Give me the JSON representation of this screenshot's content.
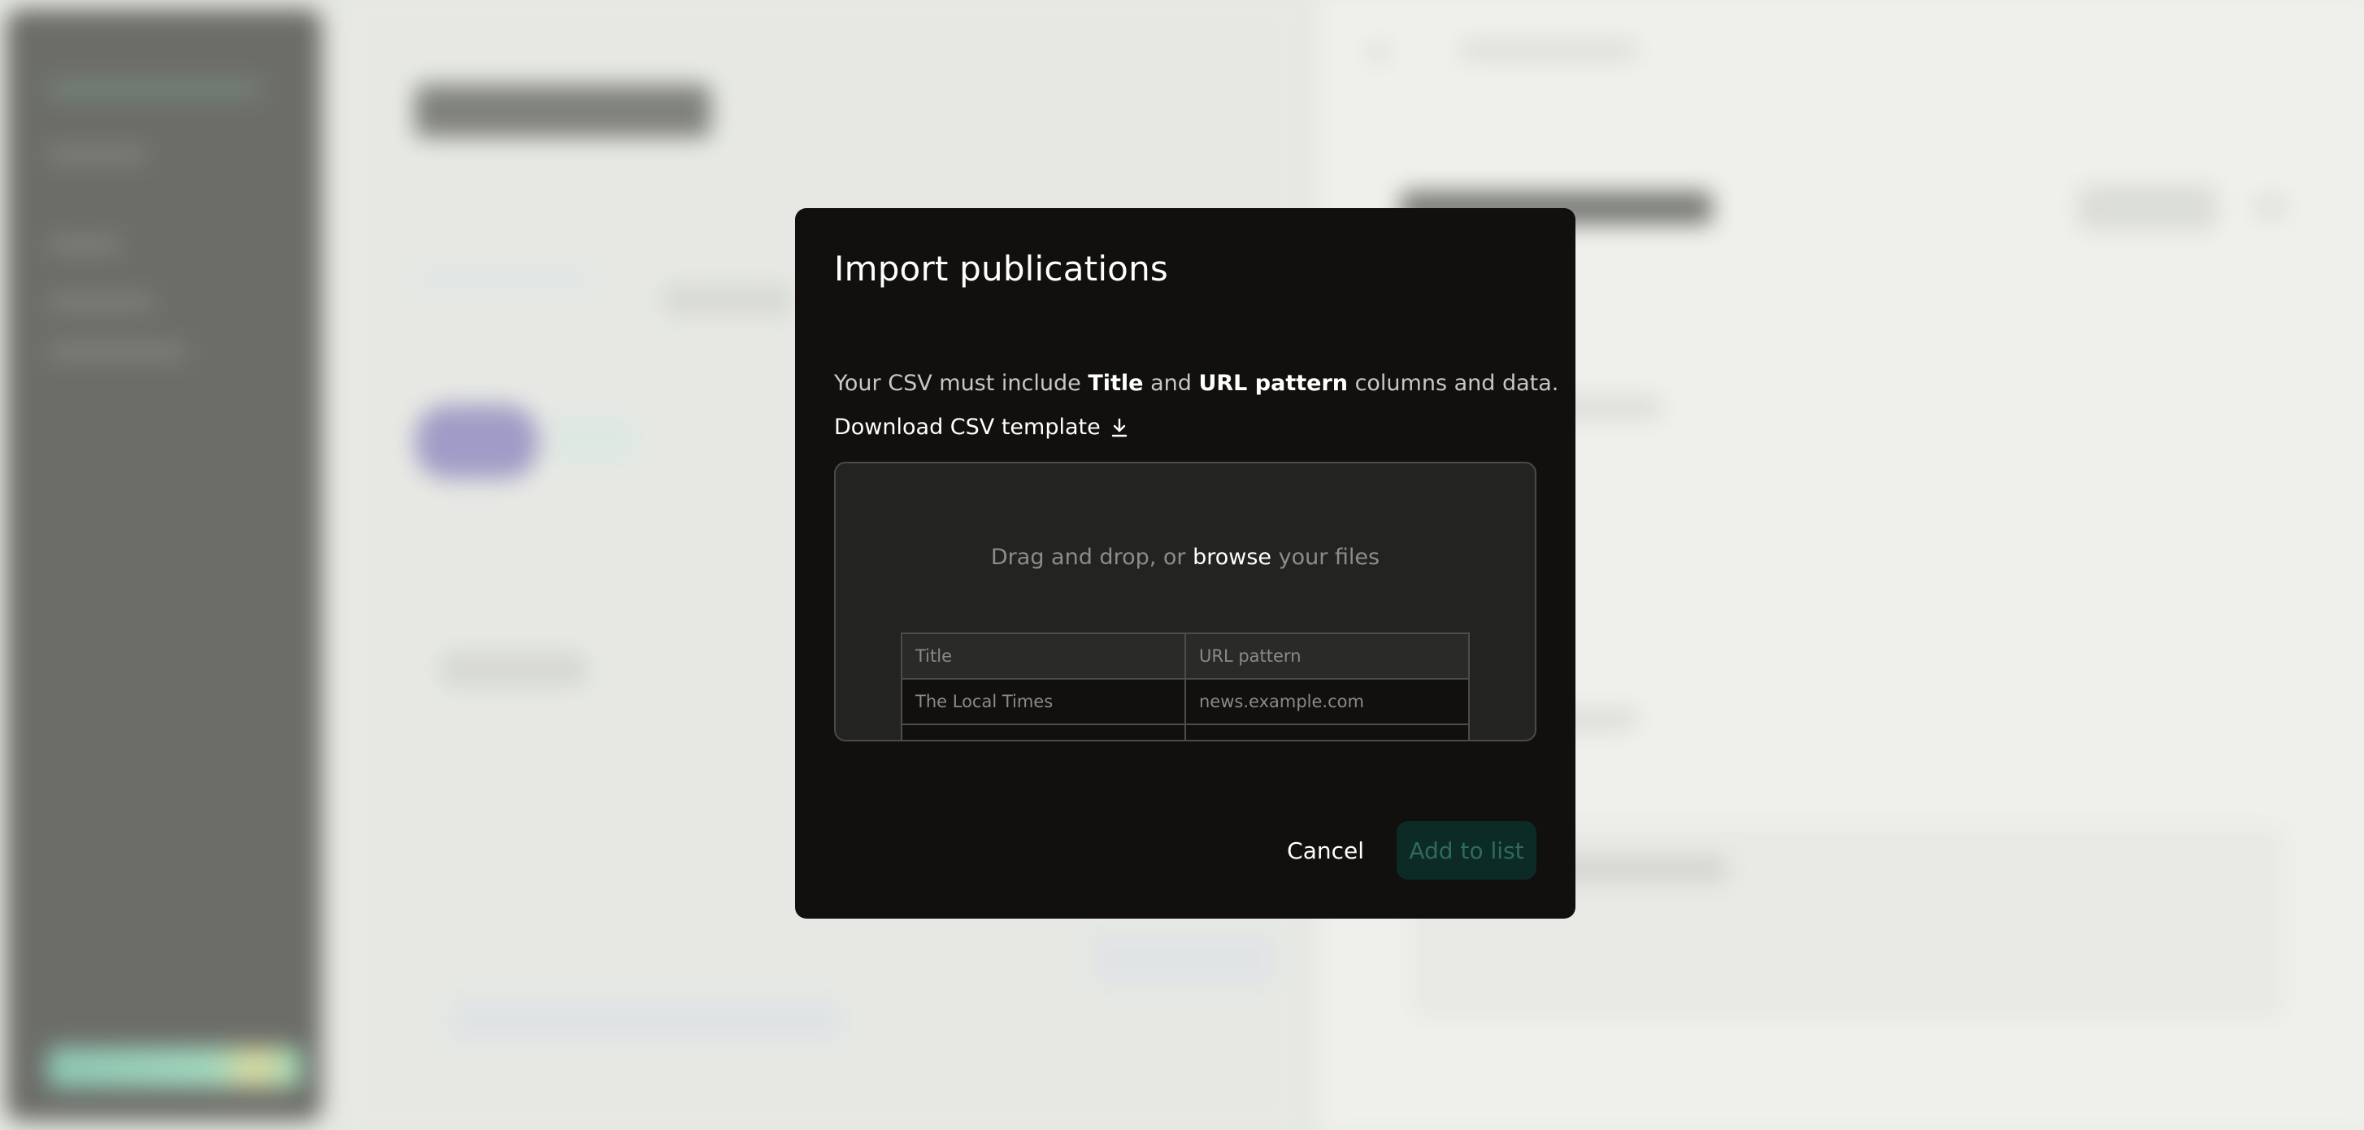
{
  "modal": {
    "title": "Import publications",
    "description": {
      "prefix": "Your CSV must include ",
      "field1": "Title",
      "and": " and ",
      "field2": "URL pattern",
      "suffix": " columns and data."
    },
    "download_label": "Download CSV template",
    "dropzone": {
      "prefix": "Drag and drop, or ",
      "browse": "browse",
      "suffix": " your files"
    },
    "table": {
      "headers": [
        "Title",
        "URL pattern"
      ],
      "rows": [
        [
          "The Local Times",
          "news.example.com"
        ]
      ]
    },
    "cancel_label": "Cancel",
    "add_label": "Add to list"
  },
  "colors": {
    "modal_bg": "#11100e",
    "add_button_bg": "#0d2b26",
    "add_button_text": "#2f6a5c"
  },
  "icons": {
    "download": "download-icon"
  }
}
